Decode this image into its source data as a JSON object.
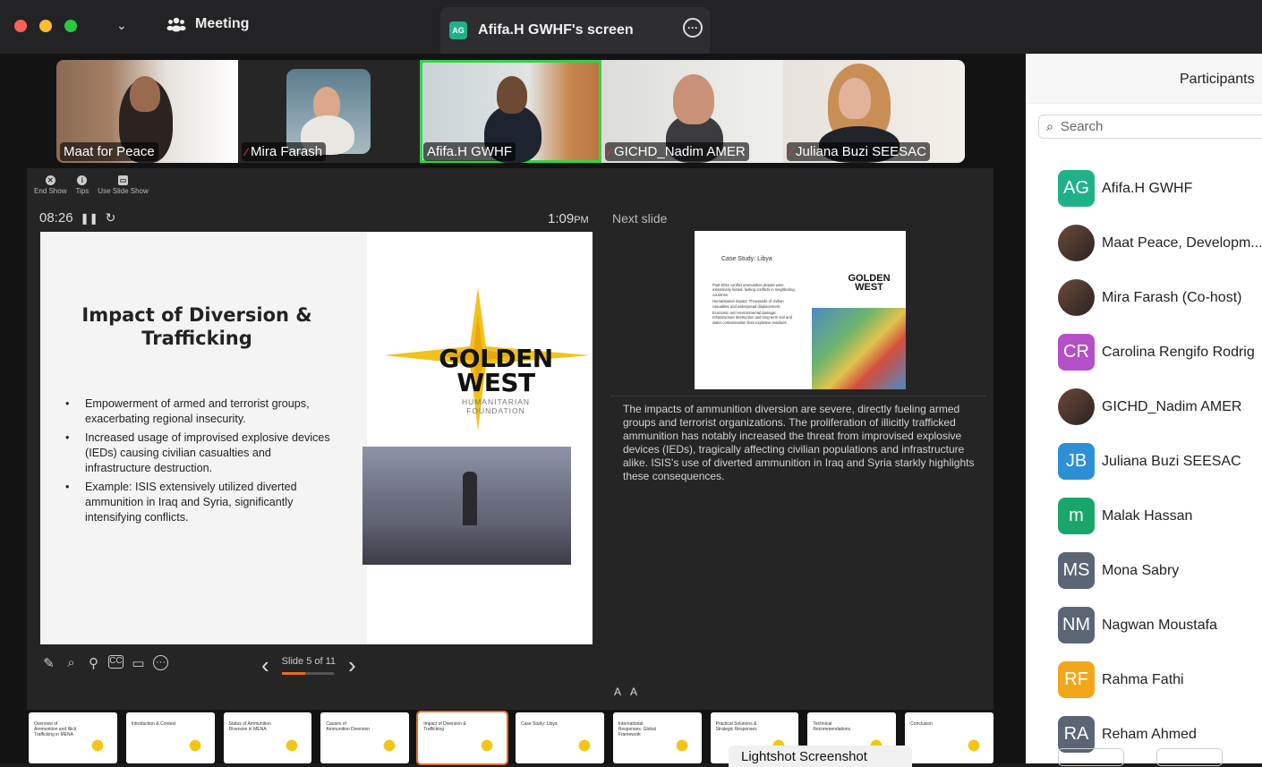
{
  "window": {
    "app_title": "Meeting",
    "share_tab_badge": "AG",
    "share_tab_title": "Afifa.H GWHF's screen"
  },
  "video_tiles": [
    {
      "name": "Maat for Peace",
      "muted": false,
      "active": false
    },
    {
      "name": "Mira Farash",
      "muted": true,
      "active": false
    },
    {
      "name": "Afifa.H GWHF",
      "muted": false,
      "active": true
    },
    {
      "name": "GICHD_Nadim AMER",
      "muted": true,
      "active": false
    },
    {
      "name": "Juliana Buzi SEESAC",
      "muted": true,
      "active": false
    }
  ],
  "presenter": {
    "toolbar": [
      "End Show",
      "Tips",
      "Use Slide Show"
    ],
    "elapsed": "08:26",
    "clock": "1:09",
    "clock_suffix": "PM",
    "next_label": "Next slide",
    "slide_counter": "Slide 5 of 11",
    "progress": 0.45,
    "font_buttons": [
      "A",
      "A"
    ]
  },
  "current_slide": {
    "title_line1": "Impact of Diversion &",
    "title_line2": "Trafficking",
    "bullets": [
      "Empowerment of armed and terrorist groups, exacerbating regional insecurity.",
      " Increased usage of improvised explosive devices (IEDs) causing civilian casualties and infrastructure destruction.",
      "Example: ISIS extensively utilized diverted ammunition in Iraq and Syria, significantly intensifying conflicts."
    ],
    "logo_line1": "GOLDEN",
    "logo_line2": "WEST",
    "logo_sub": "HUMANITARIAN FOUNDATION"
  },
  "next_slide": {
    "title": "Case Study: Libya",
    "bullets": [
      "Post-2011 conflict ammunition depots were extensively looted, fueling conflicts in neighboring countries.",
      "Humanitarian impact: Thousands of civilian casualties and widespread displacement.",
      "Economic and environmental damage: Infrastructure destruction and long-term soil and water contamination from explosive residues."
    ],
    "logo_line1": "GOLDEN",
    "logo_line2": "WEST"
  },
  "notes": "The impacts of ammunition diversion are severe, directly fueling armed groups and terrorist organizations. The proliferation of illicitly trafficked ammunition has notably increased the threat from improvised explosive devices (IEDs), tragically affecting civilian populations and infrastructure alike. ISIS's use of diverted ammunition in Iraq and Syria starkly highlights these consequences.",
  "thumbnails": [
    {
      "title": "Overview of Ammunition and Illicit Trafficking in MENA",
      "current": false
    },
    {
      "title": "Introduction & Context",
      "current": false
    },
    {
      "title": "Status of Ammunition Diversion in MENA",
      "current": false
    },
    {
      "title": "Causes of Ammunition Diversion",
      "current": false
    },
    {
      "title": "Impact of Diversion & Trafficking",
      "current": true
    },
    {
      "title": "Case Study: Libya",
      "current": false
    },
    {
      "title": "International Responses: Global Framework",
      "current": false
    },
    {
      "title": "Practical Solutions & Strategic Responses",
      "current": false
    },
    {
      "title": "Technical Recommendations",
      "current": false
    },
    {
      "title": "Conclusion",
      "current": false
    }
  ],
  "overlay": {
    "lightshot": "Lightshot Screenshot"
  },
  "participants": {
    "header": "Participants",
    "search_placeholder": "Search",
    "list": [
      {
        "initials": "AG",
        "name": "Afifa.H GWHF",
        "color": "#1fb28a",
        "photo": false
      },
      {
        "initials": "",
        "name": "Maat Peace, Developm...",
        "color": "",
        "photo": true
      },
      {
        "initials": "",
        "name": "Mira Farash (Co-host)",
        "color": "",
        "photo": true
      },
      {
        "initials": "CR",
        "name": "Carolina Rengifo Rodrig",
        "color": "#b44fc8",
        "photo": false
      },
      {
        "initials": "",
        "name": "GICHD_Nadim AMER",
        "color": "",
        "photo": true
      },
      {
        "initials": "JB",
        "name": "Juliana Buzi SEESAC",
        "color": "#2d8fd5",
        "photo": false
      },
      {
        "initials": "m",
        "name": "Malak Hassan",
        "color": "#1aa56a",
        "photo": false
      },
      {
        "initials": "MS",
        "name": "Mona Sabry",
        "color": "#5b6575",
        "photo": false
      },
      {
        "initials": "NM",
        "name": "Nagwan Moustafa",
        "color": "#5b6575",
        "photo": false
      },
      {
        "initials": "RF",
        "name": "Rahma Fathi",
        "color": "#f2a71b",
        "photo": false
      },
      {
        "initials": "RA",
        "name": "Reham Ahmed",
        "color": "#5b6575",
        "photo": false
      }
    ]
  }
}
